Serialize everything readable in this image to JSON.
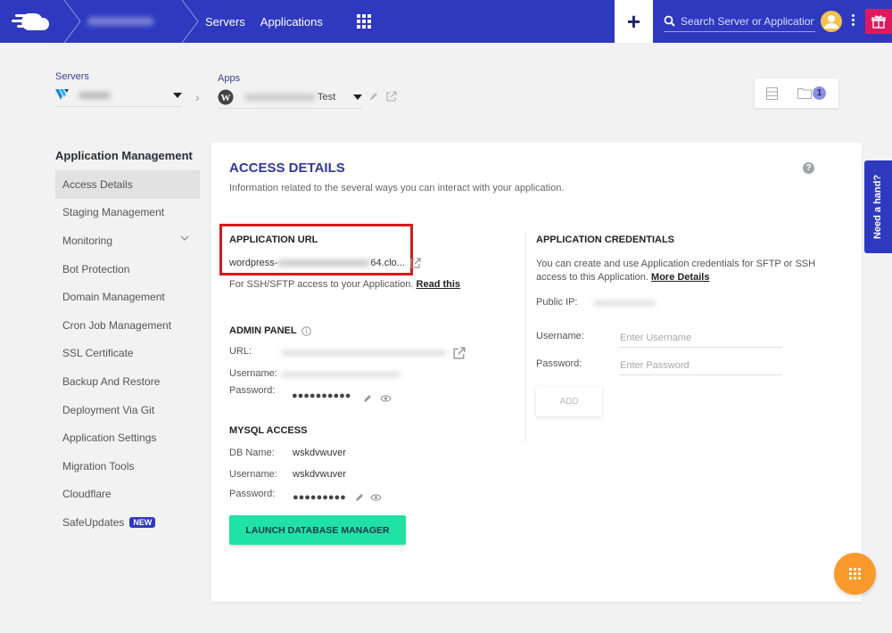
{
  "topbar": {
    "server_crumb": "Server Name",
    "nav": [
      "Servers",
      "Applications"
    ],
    "search_placeholder": "Search Server or Application"
  },
  "selectors": {
    "servers_label": "Servers",
    "server_value": "Vultr",
    "apps_label": "Apps",
    "app_value_suffix": "Test",
    "app_value_blurred": "Blurred Name"
  },
  "tools": {
    "folder_count": "1"
  },
  "sidebar": {
    "title": "Application Management",
    "items": [
      {
        "label": "Access Details",
        "active": true
      },
      {
        "label": "Staging Management"
      },
      {
        "label": "Monitoring",
        "expandable": true
      },
      {
        "label": "Bot Protection"
      },
      {
        "label": "Domain Management"
      },
      {
        "label": "Cron Job Management"
      },
      {
        "label": "SSL Certificate"
      },
      {
        "label": "Backup And Restore"
      },
      {
        "label": "Deployment Via Git"
      },
      {
        "label": "Application Settings"
      },
      {
        "label": "Migration Tools"
      },
      {
        "label": "Cloudflare"
      },
      {
        "label": "SafeUpdates",
        "badge": "NEW"
      }
    ]
  },
  "access": {
    "title": "ACCESS DETAILS",
    "subtitle": "Information related to the several ways you can interact with your application.",
    "app_url": {
      "heading": "APPLICATION URL",
      "prefix": "wordpress-",
      "suffix": "64.clo...",
      "ssh_note": "For SSH/SFTP access to your Application.",
      "read_this": "Read this"
    },
    "admin_panel": {
      "heading": "ADMIN PANEL",
      "url_label": "URL:",
      "username_label": "Username:",
      "password_label": "Password:",
      "password_mask": "●●●●●●●●●●"
    },
    "mysql": {
      "heading": "MYSQL ACCESS",
      "db_name_label": "DB Name:",
      "db_name": "wskdvwuver",
      "username_label": "Username:",
      "username": "wskdvwuver",
      "password_label": "Password:",
      "password_mask": "●●●●●●●●●",
      "launch_button": "LAUNCH DATABASE MANAGER"
    },
    "credentials": {
      "heading": "APPLICATION CREDENTIALS",
      "description": "You can create and use Application credentials for SFTP or SSH access to this Application.",
      "more_details": "More Details",
      "public_ip_label": "Public IP:",
      "username_label": "Username:",
      "username_placeholder": "Enter Username",
      "password_label": "Password:",
      "password_placeholder": "Enter Password",
      "add_button": "ADD"
    }
  },
  "help_tab": "Need a hand?"
}
